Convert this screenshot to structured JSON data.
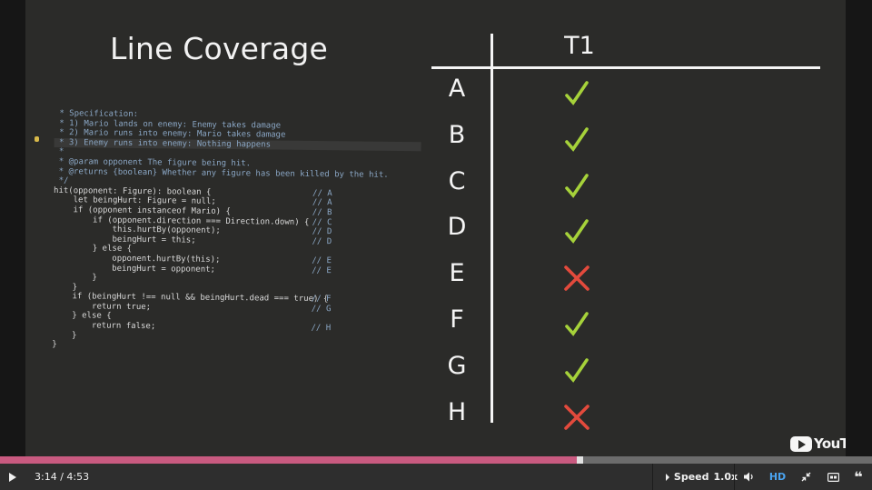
{
  "slide": {
    "title": "Line Coverage",
    "table": {
      "column_header": "T1",
      "rows": [
        {
          "label": "A",
          "result": "pass"
        },
        {
          "label": "B",
          "result": "pass"
        },
        {
          "label": "C",
          "result": "pass"
        },
        {
          "label": "D",
          "result": "pass"
        },
        {
          "label": "E",
          "result": "fail"
        },
        {
          "label": "F",
          "result": "pass"
        },
        {
          "label": "G",
          "result": "pass"
        },
        {
          "label": "H",
          "result": "fail"
        }
      ],
      "colors": {
        "pass": "#a6d23a",
        "fail": "#e34a3c"
      }
    },
    "code": [
      {
        "text": " * Specification:",
        "ref": "",
        "comment": true
      },
      {
        "text": " * 1) Mario lands on enemy: Enemy takes damage",
        "ref": "",
        "comment": true
      },
      {
        "text": " * 2) Mario runs into enemy: Mario takes damage",
        "ref": "",
        "comment": true
      },
      {
        "text": " * 3) Enemy runs into enemy: Nothing happens",
        "ref": "",
        "comment": true,
        "highlight": true
      },
      {
        "text": " *",
        "ref": "",
        "comment": true
      },
      {
        "text": " * @param opponent The figure being hit.",
        "ref": "",
        "comment": true
      },
      {
        "text": " * @returns {boolean} Whether any figure has been killed by the hit.",
        "ref": "",
        "comment": true
      },
      {
        "text": " */",
        "ref": "",
        "comment": true
      },
      {
        "text": "hit(opponent: Figure): boolean {",
        "ref": "// A"
      },
      {
        "text": "    let beingHurt: Figure = null;",
        "ref": "// A"
      },
      {
        "text": "    if (opponent instanceof Mario) {",
        "ref": "// B"
      },
      {
        "text": "        if (opponent.direction === Direction.down) {",
        "ref": "// C"
      },
      {
        "text": "            this.hurtBy(opponent);",
        "ref": "// D"
      },
      {
        "text": "            beingHurt = this;",
        "ref": "// D"
      },
      {
        "text": "        } else {",
        "ref": ""
      },
      {
        "text": "            opponent.hurtBy(this);",
        "ref": "// E"
      },
      {
        "text": "            beingHurt = opponent;",
        "ref": "// E"
      },
      {
        "text": "        }",
        "ref": ""
      },
      {
        "text": "    }",
        "ref": ""
      },
      {
        "text": "    if (beingHurt !== null && beingHurt.dead === true) {",
        "ref": "// F"
      },
      {
        "text": "        return true;",
        "ref": "// G"
      },
      {
        "text": "    } else {",
        "ref": ""
      },
      {
        "text": "        return false;",
        "ref": "// H"
      },
      {
        "text": "    }",
        "ref": ""
      },
      {
        "text": "}",
        "ref": ""
      }
    ],
    "watermark": "YouTube"
  },
  "player": {
    "progress": 0.665,
    "current_time": "3:14",
    "duration": "4:53",
    "time_display": "3:14 / 4:53",
    "speed_label": "Speed",
    "speed_value": "1.0x",
    "hd_label": "HD",
    "quote_label": "❝",
    "colors": {
      "progress": "#c95a80",
      "hd": "#4aa3ef"
    },
    "icons": [
      "play-icon",
      "speed-arrow-icon",
      "volume-icon",
      "fullscreen-exit-icon",
      "captions-icon",
      "quote-icon"
    ]
  }
}
